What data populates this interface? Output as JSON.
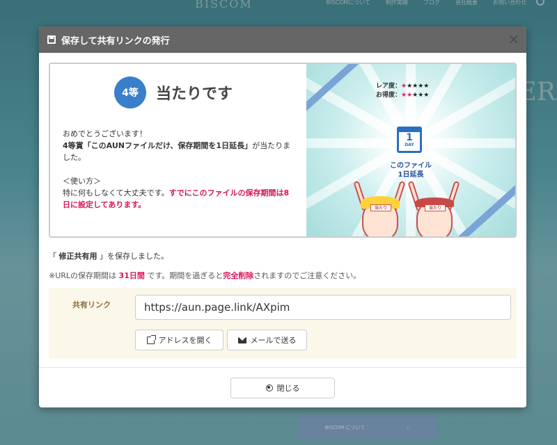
{
  "background": {
    "logo": "BISCOM",
    "nav": [
      "BISCOMについて",
      "制作実績",
      "ブログ",
      "会社概要",
      "お問い合わせ"
    ],
    "hero_fragment": "ER",
    "bottom_button": "BISCOM について"
  },
  "modal": {
    "title": "保存して共有リンクの発行",
    "close_symbol": "×",
    "result": {
      "rank_badge": "4等",
      "heading": "当たりです",
      "line1": "おめでとうございます！",
      "line2_bold": "4等賞「このAUNファイルだけ、保存期間を1日延長」",
      "line2_rest": "が当たりました。",
      "usage_label": "＜使い方＞",
      "usage_plain": "特に何もしなくて大丈夫です。",
      "usage_pink": "すでにこのファイルの保存期間は8日に設定してあります。",
      "image": {
        "rarity_label": "レア度：",
        "rarity_on": "★",
        "rarity_off": "★★★★",
        "value_label": "お得度：",
        "value_on": "★★",
        "value_off": "★★★",
        "calendar_number": "1",
        "calendar_day": "DAY",
        "caption_line1": "このファイル",
        "caption_line2": "1日延長",
        "headband1": "当たり",
        "headband2": "当たり"
      }
    },
    "saved_prefix": "「",
    "saved_name": "修正共有用",
    "saved_suffix": "」を保存しました。",
    "notice_prefix": "※URLの保存期間は ",
    "notice_days": "31日間",
    "notice_mid": " です。期間を過ぎると",
    "notice_delete": "完全削除",
    "notice_suffix": "されますのでご注意ください。",
    "share": {
      "label": "共有リンク",
      "url": "https://aun.page.link/AXpim",
      "open_button": "アドレスを開く",
      "mail_button": "メールで送る"
    },
    "close_button": "閉じる"
  }
}
